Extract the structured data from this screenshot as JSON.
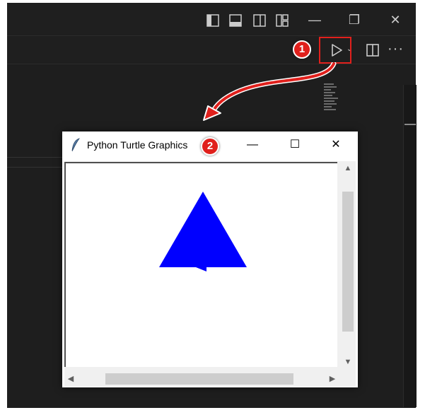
{
  "editor": {
    "window_controls": {
      "minimize_glyph": "—",
      "restore_glyph": "❐",
      "close_glyph": "✕"
    },
    "toolbar": {
      "run_icon": "play-icon",
      "chevron": "⌄",
      "split_icon": "split-editor-icon",
      "more_glyph": "···"
    }
  },
  "annotations": {
    "step1": "1",
    "step2": "2",
    "accent_color": "#e0201c"
  },
  "turtle_window": {
    "title": "Python Turtle Graphics",
    "controls": {
      "minimize_glyph": "—",
      "maximize_glyph": "☐",
      "close_glyph": "✕"
    },
    "scroll_arrows": {
      "up": "▲",
      "down": "▼",
      "left": "◀",
      "right": "▶"
    },
    "triangle_color": "#0000ff"
  }
}
